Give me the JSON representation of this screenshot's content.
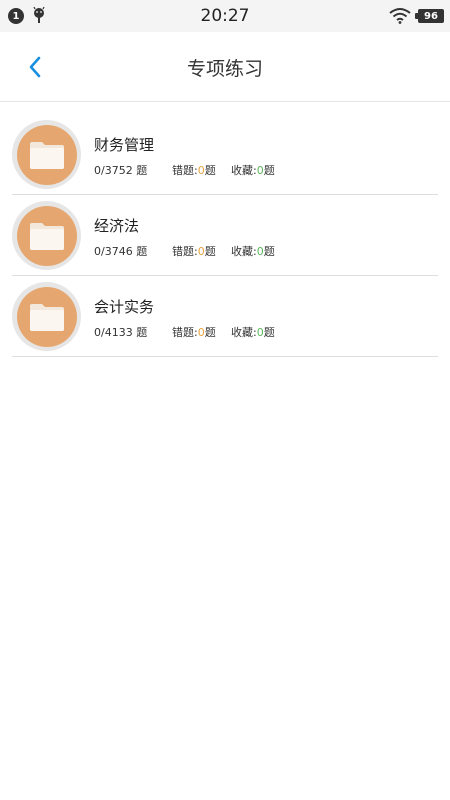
{
  "status_bar": {
    "notification_count": "1",
    "time": "20:27",
    "battery": "96",
    "icons": [
      "notification-badge",
      "android-icon",
      "wifi-icon",
      "battery-icon"
    ]
  },
  "nav": {
    "back_icon": "chevron-left-icon",
    "title": "专项练习"
  },
  "colors": {
    "accent_blue": "#1a8fe0",
    "avatar_orange": "#e5a76f",
    "error_count": "#e8a23d",
    "fav_count": "#5cb85c"
  },
  "subjects": [
    {
      "name": "财务管理",
      "progress": "0/3752 题",
      "errors_label": "错题:",
      "errors_count": "0",
      "errors_unit": "题",
      "favs_label": "收藏:",
      "favs_count": "0",
      "favs_unit": "题",
      "icon": "folder-icon"
    },
    {
      "name": "经济法",
      "progress": "0/3746 题",
      "errors_label": "错题:",
      "errors_count": "0",
      "errors_unit": "题",
      "favs_label": "收藏:",
      "favs_count": "0",
      "favs_unit": "题",
      "icon": "folder-icon"
    },
    {
      "name": "会计实务",
      "progress": "0/4133 题",
      "errors_label": "错题:",
      "errors_count": "0",
      "errors_unit": "题",
      "favs_label": "收藏:",
      "favs_count": "0",
      "favs_unit": "题",
      "icon": "folder-icon"
    }
  ]
}
